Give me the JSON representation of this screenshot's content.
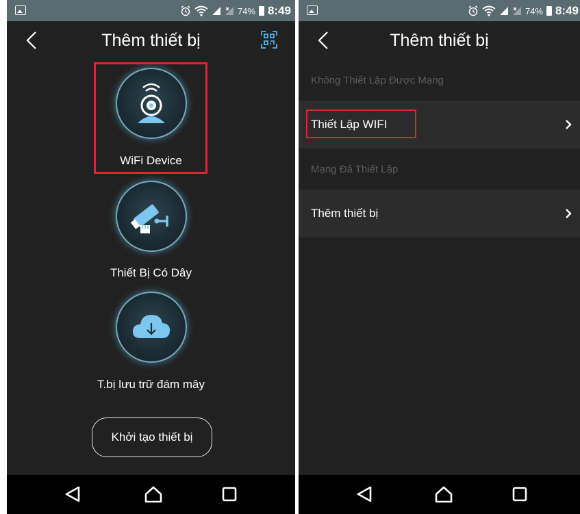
{
  "status_bar": {
    "battery": "74%",
    "time": "8:49"
  },
  "left_screen": {
    "title": "Thêm thiết bị",
    "options": [
      {
        "label": "WiFi Device",
        "icon": "wifi-camera-icon"
      },
      {
        "label": "Thiết Bị Có Dây",
        "icon": "wired-camera-icon"
      },
      {
        "label": "T.bị lưu trữ đám mây",
        "icon": "cloud-download-icon"
      }
    ],
    "init_button": "Khởi tạo thiết bị"
  },
  "right_screen": {
    "title": "Thêm thiết bị",
    "sections": [
      {
        "header": "Không Thiết Lập Được Mạng",
        "item": "Thiết Lập WIFI"
      },
      {
        "header": "Mạng Đã Thiết Lập",
        "item": "Thêm thiết bị"
      }
    ]
  },
  "colors": {
    "background": "#212121",
    "row_background": "#2c2c2c",
    "status_bar": "#5a6b72",
    "highlight": "#e0262f",
    "accent_blue": "#7dc6ef"
  },
  "icons": {
    "back": "chevron-left-icon",
    "qr": "qr-scan-icon",
    "row_arrow": "chevron-right-icon",
    "nav": [
      "back-triangle-icon",
      "home-icon",
      "recents-icon"
    ]
  }
}
